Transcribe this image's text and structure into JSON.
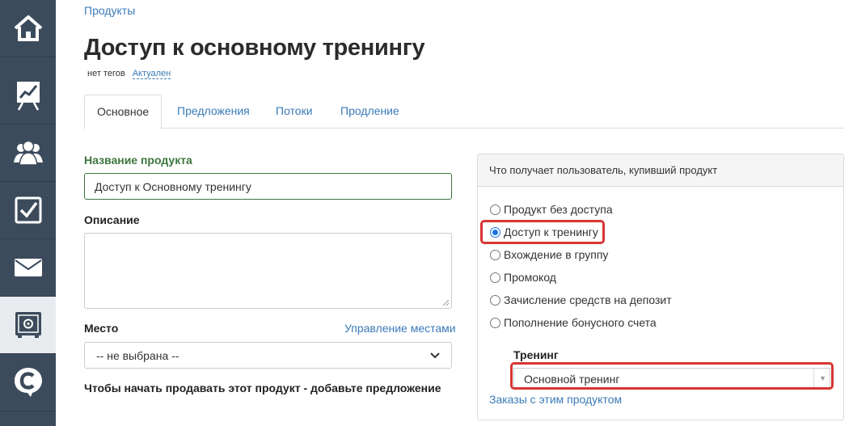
{
  "breadcrumb": "Продукты",
  "title": "Доступ к основному тренингу",
  "meta": {
    "tags": "нет тегов",
    "status": "Актуален"
  },
  "tabs": [
    {
      "label": "Основное",
      "active": true
    },
    {
      "label": "Предложения"
    },
    {
      "label": "Потоки"
    },
    {
      "label": "Продление"
    }
  ],
  "form": {
    "name_label": "Название продукта",
    "name_value": "Доступ к Основному тренингу",
    "description_label": "Описание",
    "place_label": "Место",
    "manage_places_link": "Управление местами",
    "place_select_value": "-- не выбрана --",
    "hint": "Чтобы начать продавать этот продукт - добавьте предложение"
  },
  "panel": {
    "header": "Что получает пользователь, купивший продукт",
    "options": [
      {
        "label": "Продукт без доступа",
        "checked": false
      },
      {
        "label": "Доступ к тренингу",
        "checked": true
      },
      {
        "label": "Вхождение в группу",
        "checked": false
      },
      {
        "label": "Промокод",
        "checked": false
      },
      {
        "label": "Зачисление средств на депозит",
        "checked": false
      },
      {
        "label": "Пополнение бонусного счета",
        "checked": false
      }
    ],
    "training_label": "Тренинг",
    "training_value": "Основной тренинг",
    "orders_link": "Заказы с этим продуктом"
  },
  "sidebar": [
    {
      "icon": "home-icon"
    },
    {
      "icon": "chart-presentation-icon"
    },
    {
      "icon": "users-icon"
    },
    {
      "icon": "checkbox-icon"
    },
    {
      "icon": "mail-icon"
    },
    {
      "icon": "safe-icon",
      "active": true
    },
    {
      "icon": "brand-logo-icon"
    }
  ],
  "colors": {
    "sidebar": "#3c4b5c",
    "link": "#3a7bb8",
    "highlight": "#d93535",
    "valid": "#3c763d"
  }
}
